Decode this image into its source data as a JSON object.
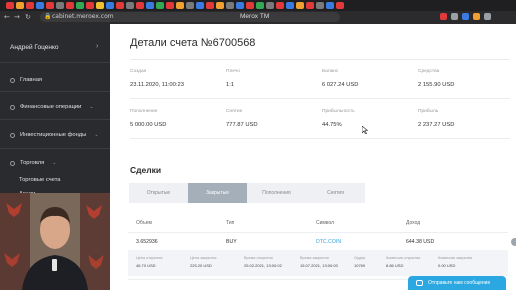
{
  "browser": {
    "url": "cabinet.meroex.com",
    "window_title": "Meroх TM",
    "tab_colors": [
      "#e23a3a",
      "#f0a030",
      "#e23a3a",
      "#3a7be2",
      "#e23a3a",
      "#7a7a7a",
      "#e23a3a",
      "#34a853",
      "#e23a3a",
      "#f0c030",
      "#3a7be2",
      "#e23a3a",
      "#7a7a7a",
      "#e23a3a",
      "#3a7be2",
      "#34a853",
      "#e23a3a",
      "#f0a030",
      "#7a7a7a",
      "#3a7be2",
      "#e23a3a",
      "#f0a030",
      "#7a7a7a",
      "#3a7be2",
      "#e23a3a",
      "#34a853",
      "#7a7a7a",
      "#e23a3a",
      "#3a7be2",
      "#f0a030",
      "#e23a3a",
      "#7a7a7a",
      "#3a7be2",
      "#e23a3a"
    ],
    "extension_colors": [
      "#e23a3a",
      "#9aa0a6",
      "#3a7be2",
      "#f0a030",
      "#9aa0a6"
    ]
  },
  "sidebar": {
    "user_name": "Андрей Гоценко",
    "items": [
      {
        "label": "Главная"
      },
      {
        "label": "Финансовые операции"
      },
      {
        "label": "Инвестиционные фонды"
      },
      {
        "label": "Торговля"
      }
    ],
    "sub_items": [
      {
        "label": "Торговые счета"
      },
      {
        "label": "Акции"
      }
    ]
  },
  "account": {
    "title": "Детали счета №6700568",
    "stats_row1": [
      {
        "label": "Создан",
        "value": "23.11.2020, 11:00:23"
      },
      {
        "label": "Плечо",
        "value": "1:1"
      },
      {
        "label": "Баланс",
        "value": "6 027.24 USD"
      },
      {
        "label": "Средства",
        "value": "2 155.90 USD"
      }
    ],
    "stats_row2": [
      {
        "label": "Пополнение",
        "value": "5 000.00 USD"
      },
      {
        "label": "Снятие",
        "value": "777.87 USD"
      },
      {
        "label": "Прибыльность",
        "value": "44.75%"
      },
      {
        "label": "Прибыль",
        "value": "2 237.27 USD"
      }
    ]
  },
  "deals": {
    "title": "Сделки",
    "tabs": [
      {
        "label": "Открытые",
        "active": false
      },
      {
        "label": "Закрытые",
        "active": true
      },
      {
        "label": "Пополнения",
        "active": false
      },
      {
        "label": "Снятия",
        "active": false
      }
    ],
    "columns": [
      "Объем",
      "Тип",
      "Символ",
      "Доход"
    ],
    "rows": [
      {
        "volume": "3.652936",
        "type": "BUY",
        "symbol": "DTC.COIN",
        "income": "644.38 USD"
      }
    ],
    "detail": [
      {
        "label": "Цена открытия",
        "value": "46.70 USD"
      },
      {
        "label": "Цена закрытия",
        "value": "225.20 USD"
      },
      {
        "label": "Время открытия",
        "value": "25.02.2021, 13:00:02"
      },
      {
        "label": "Время закрытия",
        "value": "15.07.2021, 13:00:00"
      },
      {
        "label": "Ордер",
        "value": "10769"
      },
      {
        "label": "Комиссия открытия",
        "value": "8.86 USD"
      },
      {
        "label": "Комиссия закрытия",
        "value": "0.00 USD"
      }
    ]
  },
  "chat": {
    "label": "Отправьте нам сообщение"
  },
  "colors": {
    "accent": "#3aa2df",
    "sidebar": "#2a2b2f",
    "tab_active": "#a4afb9",
    "chat": "#2ba8e1"
  }
}
